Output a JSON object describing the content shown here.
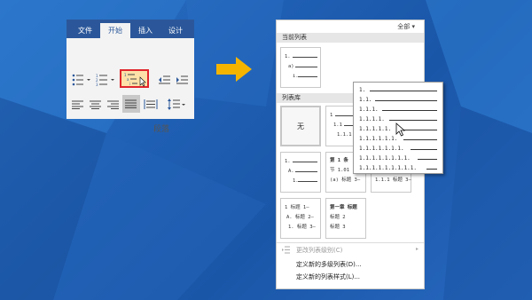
{
  "ribbon": {
    "tabs": [
      "文件",
      "开始",
      "插入",
      "设计"
    ],
    "active_tab": "开始",
    "group_label": "段落"
  },
  "panel": {
    "filter_label": "全部 ▾",
    "current_section": "当前列表",
    "library_section": "列表库",
    "none_label": "无",
    "current_list": [
      "1.",
      "a)",
      "i."
    ],
    "thumbs": {
      "t2": [
        "1",
        "1.1",
        "1.1.1"
      ],
      "t4": [
        "1.",
        "A.",
        "1."
      ],
      "t5": [
        "第 1 条",
        "节 1.01",
        "(a) 标题 3—"
      ],
      "t7": [
        "1 标题 1—",
        "A. 标题 2—",
        "1. 标题 3—"
      ],
      "t8": [
        "第一章 标题",
        "标题 2",
        "标题 3"
      ],
      "t6": [
        "1.1.1 标题 3—"
      ]
    },
    "menu": [
      {
        "label": "更改列表级别(C)",
        "enabled": false
      },
      {
        "label": "定义新的多级列表(D)...",
        "enabled": true
      },
      {
        "label": "定义新的列表样式(L)...",
        "enabled": true
      }
    ]
  },
  "popup": {
    "levels": [
      "1.",
      "1.1.",
      "1.1.1.",
      "1.1.1.1.",
      "1.1.1.1.1.",
      "1.1.1.1.1.1.",
      "1.1.1.1.1.1.1.",
      "1.1.1.1.1.1.1.1.",
      "1.1.1.1.1.1.1.1.1."
    ]
  },
  "colors": {
    "accent": "#2b579a",
    "highlight_border": "#e0262c",
    "arrow": "#f5b400",
    "background": "#1f5fb3"
  }
}
